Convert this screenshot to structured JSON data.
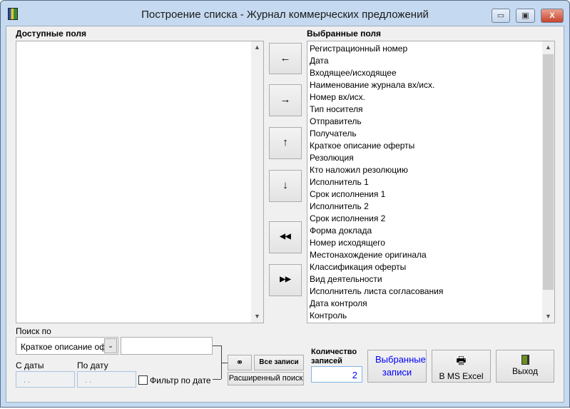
{
  "window": {
    "title": "Построение списка - Журнал коммерческих предложений",
    "minimize": "▭",
    "maximize": "▣",
    "close": "X"
  },
  "available": {
    "label": "Доступные поля",
    "items": []
  },
  "selected": {
    "label": "Выбранные поля",
    "items": [
      "Регистрационный номер",
      "Дата",
      "Входящее/исходящее",
      "Наименование журнала вх/исх.",
      "Номер вх/исх.",
      "Тип носителя",
      "Отправитель",
      "Получатель",
      "Краткое описание оферты",
      "Резолюция",
      "Кто наложил резолюцию",
      "Исполнитель 1",
      "Срок исполнения 1",
      "Исполнитель 2",
      "Срок исполнения 2",
      "Форма доклада",
      "Номер исходящего",
      "Местонахождение оригинала",
      "Классификация оферты",
      "Вид деятельности",
      "Исполнитель листа согласования",
      "Дата контроля",
      "Контроль"
    ]
  },
  "move_buttons": {
    "remove": "←",
    "add": "→",
    "up": "↑",
    "down": "↓",
    "remove_all": "◀◀",
    "add_all": "▶▶"
  },
  "search": {
    "label": "Поиск по",
    "field_value": "Краткое описание оф",
    "query": "",
    "from_label": "С даты",
    "from_value": ". .",
    "to_label": "По дату",
    "to_value": ". .",
    "date_filter_label": "Фильтр по дате",
    "date_filter_checked": false,
    "find_icon": "binoculars-icon",
    "all_records": "Все записи",
    "advanced": "Расширенный поиск"
  },
  "count": {
    "label": "Количество записей",
    "value": "2"
  },
  "actions": {
    "selected_records": "Выбранные записи",
    "excel": "В MS Excel",
    "exit": "Выход"
  },
  "colors": {
    "link_blue": "#0000ff",
    "frame": "#c5daf0",
    "close_red": "#c7432d"
  }
}
